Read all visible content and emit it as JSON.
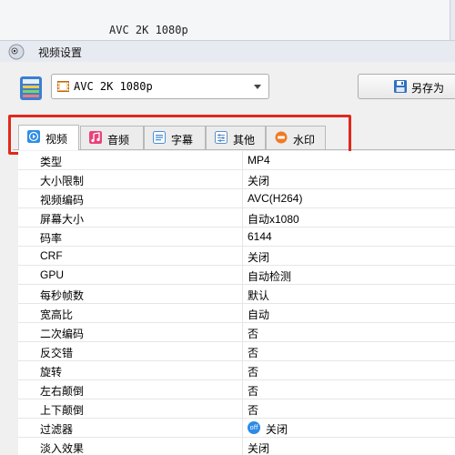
{
  "background_window": {
    "title": "AVC 2K 1080p"
  },
  "dialog": {
    "title": "视频设置"
  },
  "preset": {
    "value": "AVC 2K 1080p",
    "save_as_label": "另存为"
  },
  "tabs": [
    {
      "label": "视频",
      "icon": "play-icon",
      "color": "#2f8de4",
      "active": true
    },
    {
      "label": "音频",
      "icon": "music-note-icon",
      "color": "#e8437a",
      "active": false
    },
    {
      "label": "字幕",
      "icon": "subtitle-icon",
      "color": "#4a8fd8",
      "active": false
    },
    {
      "label": "其他",
      "icon": "sliders-icon",
      "color": "#5b8fc8",
      "active": false
    },
    {
      "label": "水印",
      "icon": "watermark-icon",
      "color": "#f07a24",
      "active": false
    }
  ],
  "properties": [
    {
      "key": "类型",
      "value": "MP4"
    },
    {
      "key": "大小限制",
      "value": "关闭"
    },
    {
      "key": "视频编码",
      "value": "AVC(H264)"
    },
    {
      "key": "屏幕大小",
      "value": "自动x1080"
    },
    {
      "key": "码率",
      "value": "6144"
    },
    {
      "key": "CRF",
      "value": "关闭"
    },
    {
      "key": "GPU",
      "value": "自动检测"
    },
    {
      "key": "每秒帧数",
      "value": "默认"
    },
    {
      "key": "宽高比",
      "value": "自动"
    },
    {
      "key": "二次编码",
      "value": "否"
    },
    {
      "key": "反交错",
      "value": "否"
    },
    {
      "key": "旋转",
      "value": "否"
    },
    {
      "key": "左右颠倒",
      "value": "否"
    },
    {
      "key": "上下颠倒",
      "value": "否"
    },
    {
      "key": "过滤器",
      "value": "关闭",
      "toggle_text": "off"
    },
    {
      "key": "淡入效果",
      "value": "关闭"
    }
  ],
  "colors": {
    "highlight": "#e0281c",
    "active_tab": "#ffffff",
    "toggle": "#2c8be6"
  }
}
